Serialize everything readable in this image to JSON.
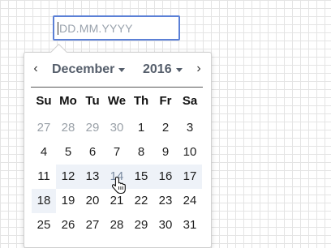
{
  "date_input": {
    "placeholder": "DD.MM.YYYY"
  },
  "calendar": {
    "prev_label": "‹",
    "next_label": "›",
    "month": "December",
    "year": "2016",
    "weekdays": [
      "Su",
      "Mo",
      "Tu",
      "We",
      "Th",
      "Fr",
      "Sa"
    ],
    "weeks": [
      [
        "27",
        "28",
        "29",
        "30",
        "1",
        "2",
        "3"
      ],
      [
        "4",
        "5",
        "6",
        "7",
        "8",
        "9",
        "10"
      ],
      [
        "11",
        "12",
        "13",
        "14",
        "15",
        "16",
        "17"
      ],
      [
        "18",
        "19",
        "20",
        "21",
        "22",
        "23",
        "24"
      ],
      [
        "25",
        "26",
        "27",
        "28",
        "29",
        "30",
        "31"
      ]
    ]
  }
}
